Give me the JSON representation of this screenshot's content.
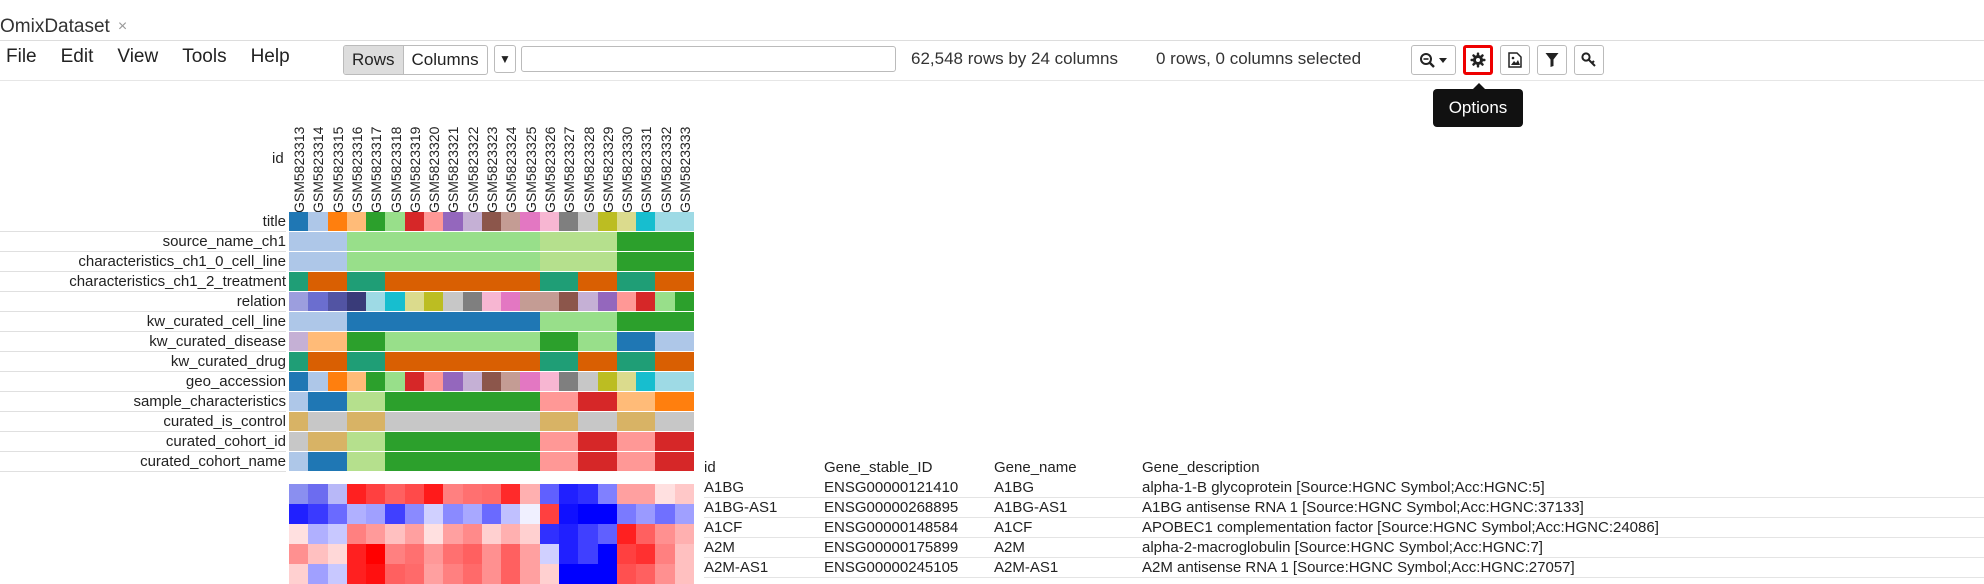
{
  "tab": {
    "title": "OmixDataset",
    "close": "×"
  },
  "menu": [
    "File",
    "Edit",
    "View",
    "Tools",
    "Help"
  ],
  "toggle": {
    "rows": "Rows",
    "columns": "Columns",
    "active": "rows"
  },
  "search": {
    "value": "",
    "placeholder": ""
  },
  "status": {
    "dims": "62,548 rows by 24 columns",
    "selection": "0 rows, 0 columns selected"
  },
  "toolbar": {
    "zoom_icon": "zoom-icon",
    "options_icon": "gear-icon",
    "image_icon": "image-icon",
    "filter_icon": "filter-icon",
    "key_icon": "key-icon",
    "tooltip": "Options"
  },
  "id_label": "id",
  "columns": [
    "GSM5823313",
    "GSM5823314",
    "GSM5823315",
    "GSM5823316",
    "GSM5823317",
    "GSM5823318",
    "GSM5823319",
    "GSM5823320",
    "GSM5823321",
    "GSM5823322",
    "GSM5823323",
    "GSM5823324",
    "GSM5823325",
    "GSM5823326",
    "GSM5823327",
    "GSM5823328",
    "GSM5823329",
    "GSM5823330",
    "GSM5823331",
    "GSM5823332",
    "GSM5823333"
  ],
  "annotation_rows": [
    "title",
    "source_name_ch1",
    "characteristics_ch1_0_cell_line",
    "characteristics_ch1_2_treatment",
    "relation",
    "kw_curated_cell_line",
    "kw_curated_disease",
    "kw_curated_drug",
    "geo_accession",
    "sample_characteristics",
    "curated_is_control",
    "curated_cohort_id",
    "curated_cohort_name"
  ],
  "tracks": [
    [
      "#1f77b4",
      "#aec7e8",
      "#ff7f0e",
      "#ffbb78",
      "#2ca02c",
      "#98df8a",
      "#d62728",
      "#ff9896",
      "#9467bd",
      "#c5b0d5",
      "#8c564b",
      "#c49c94",
      "#e377c2",
      "#f7b6d2",
      "#7f7f7f",
      "#c7c7c7",
      "#bcbd22",
      "#dbdb8d",
      "#17becf",
      "#9edae5",
      "#9edae5"
    ],
    [
      "#aec7e8",
      "#aec7e8",
      "#aec7e8",
      "#98df8a",
      "#98df8a",
      "#98df8a",
      "#98df8a",
      "#98df8a",
      "#98df8a",
      "#98df8a",
      "#98df8a",
      "#98df8a",
      "#98df8a",
      "#b5e08d",
      "#b5e08d",
      "#b5e08d",
      "#b5e08d",
      "#2ca02c",
      "#2ca02c",
      "#2ca02c",
      "#2ca02c"
    ],
    [
      "#aec7e8",
      "#aec7e8",
      "#aec7e8",
      "#98df8a",
      "#98df8a",
      "#98df8a",
      "#98df8a",
      "#98df8a",
      "#98df8a",
      "#98df8a",
      "#98df8a",
      "#98df8a",
      "#98df8a",
      "#b5e08d",
      "#b5e08d",
      "#b5e08d",
      "#b5e08d",
      "#2ca02c",
      "#2ca02c",
      "#2ca02c",
      "#2ca02c"
    ],
    [
      "#1f9e76",
      "#d95f02",
      "#d95f02",
      "#1f9e76",
      "#1f9e76",
      "#d95f02",
      "#d95f02",
      "#d95f02",
      "#d95f02",
      "#d95f02",
      "#d95f02",
      "#d95f02",
      "#d95f02",
      "#1f9e76",
      "#1f9e76",
      "#d95f02",
      "#d95f02",
      "#1f9e76",
      "#1f9e76",
      "#d95f02",
      "#d95f02"
    ],
    [
      "#9c9ede",
      "#6b6ecf",
      "#5254a3",
      "#393b79",
      "#9edae5",
      "#17becf",
      "#dbdb8d",
      "#bcbd22",
      "#c7c7c7",
      "#7f7f7f",
      "#f7b6d2",
      "#e377c2",
      "#c49c94",
      "#c49c94",
      "#8c564b",
      "#c5b0d5",
      "#9467bd",
      "#ff9896",
      "#d62728",
      "#98df8a",
      "#2ca02c"
    ],
    [
      "#aec7e8",
      "#aec7e8",
      "#aec7e8",
      "#1f77b4",
      "#1f77b4",
      "#1f77b4",
      "#1f77b4",
      "#1f77b4",
      "#1f77b4",
      "#1f77b4",
      "#1f77b4",
      "#1f77b4",
      "#1f77b4",
      "#98df8a",
      "#98df8a",
      "#98df8a",
      "#98df8a",
      "#2ca02c",
      "#2ca02c",
      "#2ca02c",
      "#2ca02c"
    ],
    [
      "#c5b0d5",
      "#ffbb78",
      "#ffbb78",
      "#2ca02c",
      "#2ca02c",
      "#98df8a",
      "#98df8a",
      "#98df8a",
      "#98df8a",
      "#98df8a",
      "#98df8a",
      "#98df8a",
      "#98df8a",
      "#2ca02c",
      "#2ca02c",
      "#98df8a",
      "#98df8a",
      "#1f77b4",
      "#1f77b4",
      "#aec7e8",
      "#aec7e8"
    ],
    [
      "#1f9e76",
      "#d95f02",
      "#d95f02",
      "#1f9e76",
      "#1f9e76",
      "#d95f02",
      "#d95f02",
      "#d95f02",
      "#d95f02",
      "#d95f02",
      "#d95f02",
      "#d95f02",
      "#d95f02",
      "#1f9e76",
      "#1f9e76",
      "#d95f02",
      "#d95f02",
      "#1f9e76",
      "#1f9e76",
      "#d95f02",
      "#d95f02"
    ],
    [
      "#1f77b4",
      "#aec7e8",
      "#ff7f0e",
      "#ffbb78",
      "#2ca02c",
      "#98df8a",
      "#d62728",
      "#ff9896",
      "#9467bd",
      "#c5b0d5",
      "#8c564b",
      "#c49c94",
      "#e377c2",
      "#f7b6d2",
      "#7f7f7f",
      "#c7c7c7",
      "#bcbd22",
      "#dbdb8d",
      "#17becf",
      "#9edae5",
      "#9edae5"
    ],
    [
      "#aec7e8",
      "#1f77b4",
      "#1f77b4",
      "#b5e08d",
      "#b5e08d",
      "#2ca02c",
      "#2ca02c",
      "#2ca02c",
      "#2ca02c",
      "#2ca02c",
      "#2ca02c",
      "#2ca02c",
      "#2ca02c",
      "#ff9896",
      "#ff9896",
      "#d62728",
      "#d62728",
      "#ffbb78",
      "#ffbb78",
      "#ff7f0e",
      "#ff7f0e"
    ],
    [
      "#d8b365",
      "#c7c7c7",
      "#c7c7c7",
      "#d8b365",
      "#d8b365",
      "#c7c7c7",
      "#c7c7c7",
      "#c7c7c7",
      "#c7c7c7",
      "#c7c7c7",
      "#c7c7c7",
      "#c7c7c7",
      "#c7c7c7",
      "#d8b365",
      "#d8b365",
      "#c7c7c7",
      "#c7c7c7",
      "#d8b365",
      "#d8b365",
      "#c7c7c7",
      "#c7c7c7"
    ],
    [
      "#c7c7c7",
      "#d8b365",
      "#d8b365",
      "#b5e08d",
      "#b5e08d",
      "#2ca02c",
      "#2ca02c",
      "#2ca02c",
      "#2ca02c",
      "#2ca02c",
      "#2ca02c",
      "#2ca02c",
      "#2ca02c",
      "#ff9896",
      "#ff9896",
      "#d62728",
      "#d62728",
      "#ff9896",
      "#ff9896",
      "#d62728",
      "#d62728"
    ],
    [
      "#aec7e8",
      "#1f77b4",
      "#1f77b4",
      "#b5e08d",
      "#b5e08d",
      "#2ca02c",
      "#2ca02c",
      "#2ca02c",
      "#2ca02c",
      "#2ca02c",
      "#2ca02c",
      "#2ca02c",
      "#2ca02c",
      "#ff9896",
      "#ff9896",
      "#d62728",
      "#d62728",
      "#ff9896",
      "#ff9896",
      "#d62728",
      "#d62728"
    ]
  ],
  "heatmap": [
    [
      "#8a8ff0",
      "#6c6cf0",
      "#b8b8f8",
      "#ff2020",
      "#ff4040",
      "#ff6060",
      "#ff4a4a",
      "#ff1a1a",
      "#ff8080",
      "#ff7070",
      "#ff6a6a",
      "#ff2a2a",
      "#ffb0b0",
      "#6060ff",
      "#2020ff",
      "#3030ff",
      "#8080ff",
      "#ffa0a0",
      "#ffa0a0",
      "#ffe0e0",
      "#ffc8c8"
    ],
    [
      "#2020ff",
      "#3a3aff",
      "#6a6aff",
      "#b0b0ff",
      "#a0a0ff",
      "#4040ff",
      "#8a8aff",
      "#d0d0ff",
      "#8a8aff",
      "#a8a8ff",
      "#6a6aff",
      "#c0c0ff",
      "#f0f0ff",
      "#ff4040",
      "#1010ff",
      "#0000ff",
      "#0000ff",
      "#7a7aff",
      "#9a9aff",
      "#7070ff",
      "#a0a0ff"
    ],
    [
      "#ffe0e0",
      "#b0b0ff",
      "#c8c8ff",
      "#ff8080",
      "#ff9a9a",
      "#ffc0c0",
      "#ffa0a0",
      "#ffe0e0",
      "#ffa0a0",
      "#ff8a8a",
      "#ffd0d0",
      "#ffb0b0",
      "#ffd0d0",
      "#3030ff",
      "#2020ff",
      "#4040ff",
      "#6060ff",
      "#ff2020",
      "#ff6060",
      "#ff9090",
      "#ffb0b0"
    ],
    [
      "#ff9090",
      "#ffc0c0",
      "#ffd8d8",
      "#ff2020",
      "#ff0000",
      "#ff8080",
      "#ff7070",
      "#ff9898",
      "#ff7070",
      "#ff6060",
      "#ff9090",
      "#ff6060",
      "#ffa0a0",
      "#d0d0ff",
      "#2020ff",
      "#4040ff",
      "#0000ff",
      "#ff4040",
      "#ff3030",
      "#ff8080",
      "#ffc0c0"
    ],
    [
      "#ffd0d0",
      "#a0a0ff",
      "#c8c8ff",
      "#ff2020",
      "#ff1010",
      "#ff6060",
      "#ff6a6a",
      "#ffa0a0",
      "#ff8080",
      "#ff6a6a",
      "#ff9090",
      "#ff6060",
      "#ffa0a0",
      "#ffd0d0",
      "#0000ff",
      "#0000ff",
      "#0000ff",
      "#ff5050",
      "#ff6060",
      "#ff9090",
      "#ffc0c0"
    ]
  ],
  "gene_table": {
    "headers": [
      "id",
      "Gene_stable_ID",
      "Gene_name",
      "Gene_description"
    ],
    "rows": [
      [
        "A1BG",
        "ENSG00000121410",
        "A1BG",
        "alpha-1-B glycoprotein [Source:HGNC Symbol;Acc:HGNC:5]"
      ],
      [
        "A1BG-AS1",
        "ENSG00000268895",
        "A1BG-AS1",
        "A1BG antisense RNA 1 [Source:HGNC Symbol;Acc:HGNC:37133]"
      ],
      [
        "A1CF",
        "ENSG00000148584",
        "A1CF",
        "APOBEC1 complementation factor [Source:HGNC Symbol;Acc:HGNC:24086]"
      ],
      [
        "A2M",
        "ENSG00000175899",
        "A2M",
        "alpha-2-macroglobulin [Source:HGNC Symbol;Acc:HGNC:7]"
      ],
      [
        "A2M-AS1",
        "ENSG00000245105",
        "A2M-AS1",
        "A2M antisense RNA 1 [Source:HGNC Symbol;Acc:HGNC:27057]"
      ]
    ]
  }
}
